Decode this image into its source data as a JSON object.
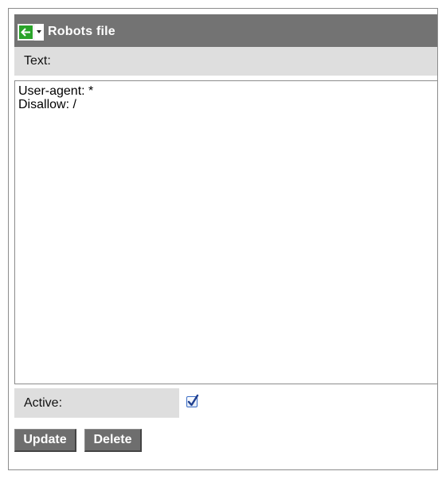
{
  "panel": {
    "title": "Robots file",
    "back_icon": "arrow-left-icon",
    "dropdown_icon": "caret-down-icon",
    "accent_green": "#29a329",
    "titlebar_color": "#737373"
  },
  "form": {
    "text_label": "Text:",
    "text_value": "User-agent: *\nDisallow: /",
    "active_label": "Active:",
    "active_checked": true
  },
  "actions": {
    "update_label": "Update",
    "delete_label": "Delete"
  }
}
